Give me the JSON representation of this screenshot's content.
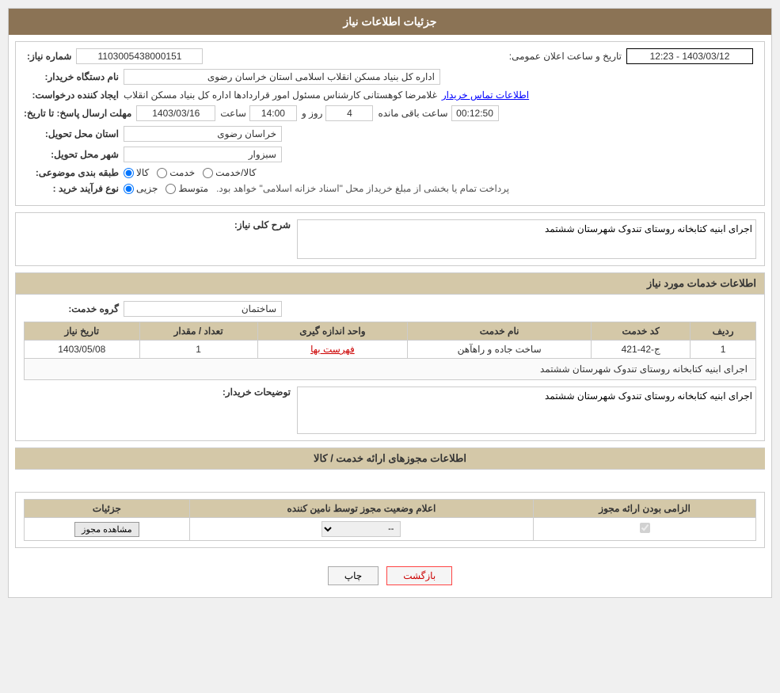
{
  "page": {
    "title": "جزئیات اطلاعات نیاز",
    "sections": {
      "general_info": {
        "label": "جزئیات اطلاعات نیاز",
        "fields": {
          "need_number_label": "شماره نیاز:",
          "need_number_value": "1103005438000151",
          "announcement_datetime_label": "تاریخ و ساعت اعلان عمومی:",
          "announcement_datetime_value": "1403/03/12 - 12:23",
          "buyer_org_label": "نام دستگاه خریدار:",
          "buyer_org_value": "اداره کل بنیاد مسکن انقلاب اسلامی استان خراسان رضوی",
          "requester_label": "ایجاد کننده درخواست:",
          "requester_name": "غلامرضا کوهستانی کارشناس مسئول امور قراردادها اداره کل بنیاد مسکن انقلاب",
          "requester_link": "اطلاعات تماس خریدار",
          "response_deadline_label": "مهلت ارسال پاسخ: تا تاریخ:",
          "deadline_date": "1403/03/16",
          "deadline_time_label": "ساعت",
          "deadline_time": "14:00",
          "deadline_days_label": "روز و",
          "deadline_days": "4",
          "deadline_remaining_label": "ساعت باقی مانده",
          "deadline_remaining": "00:12:50",
          "delivery_province_label": "استان محل تحویل:",
          "delivery_province_value": "خراسان رضوی",
          "delivery_city_label": "شهر محل تحویل:",
          "delivery_city_value": "سبزوار",
          "classification_label": "طبقه بندی موضوعی:",
          "classification_kala": "کالا",
          "classification_service": "خدمت",
          "classification_both": "کالا/خدمت",
          "purchase_type_label": "نوع فرآیند خرید :",
          "purchase_partial": "جزیی",
          "purchase_medium": "متوسط",
          "purchase_desc": "پرداخت تمام یا بخشی از مبلغ خریداز محل \"اسناد خزانه اسلامی\" خواهد بود."
        }
      },
      "need_description": {
        "label": "شرح کلی نیاز:",
        "text": "اجرای ابنیه کتابخانه روستای تندوک شهرستان ششتمد"
      },
      "services_info": {
        "label": "اطلاعات خدمات مورد نیاز",
        "service_group_label": "گروه خدمت:",
        "service_group_value": "ساختمان",
        "table": {
          "columns": [
            "ردیف",
            "کد خدمت",
            "نام خدمت",
            "واحد اندازه گیری",
            "تعداد / مقدار",
            "تاریخ نیاز"
          ],
          "rows": [
            {
              "row_num": "1",
              "service_code": "ج-42-421",
              "service_name": "ساخت جاده و راهآهن",
              "unit": "فهرست بها",
              "quantity": "1",
              "need_date": "1403/05/08",
              "description": "اجرای ابنیه کتابخانه روستای تندوک شهرستان ششتمد"
            }
          ]
        },
        "buyer_desc_label": "توضیحات خریدار:",
        "buyer_desc_text": "اجرای ابنیه کتابخانه روستای تندوک شهرستان ششتمد"
      },
      "permits_info": {
        "label": "اطلاعات مجوزهای ارائه خدمت / کالا",
        "table": {
          "columns": [
            "الزامی بودن ارائه مجوز",
            "اعلام وضعیت مجوز توسط نامین کننده",
            "جزئیات"
          ],
          "rows": [
            {
              "required": true,
              "supplier_status": "--",
              "details_btn": "مشاهده مجوز"
            }
          ]
        }
      }
    },
    "buttons": {
      "print": "چاپ",
      "back": "بازگشت"
    }
  }
}
